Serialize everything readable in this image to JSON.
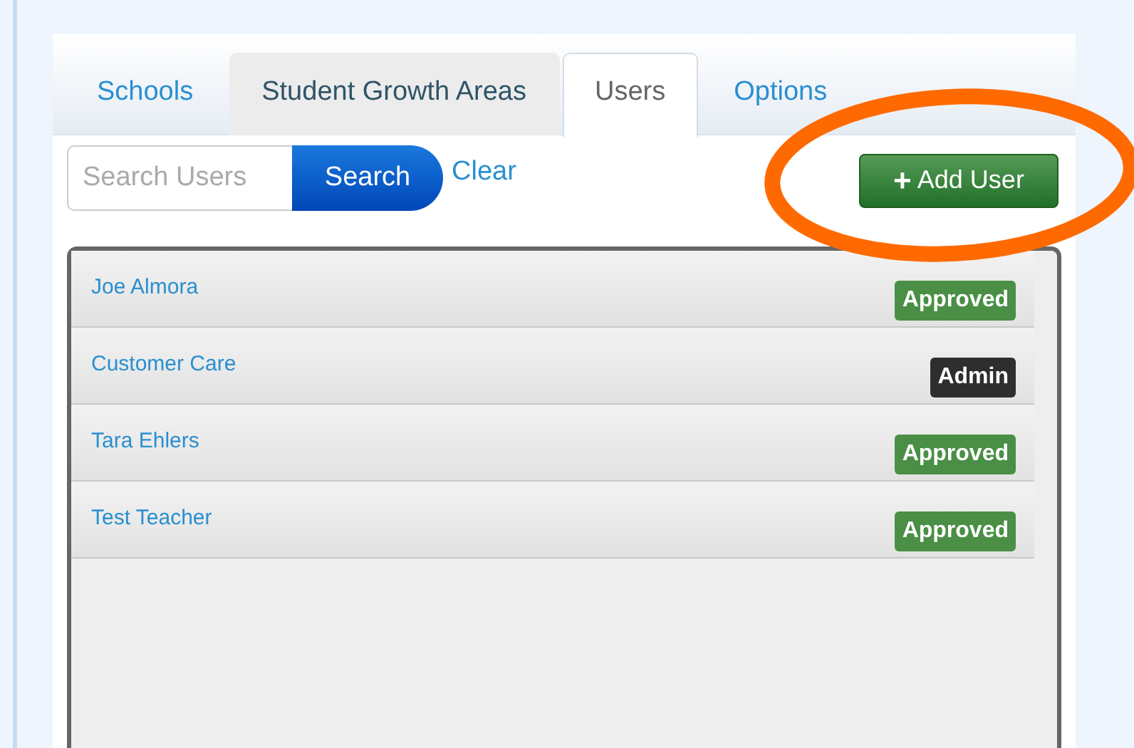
{
  "tabs": [
    {
      "label": "Schools",
      "selected": false,
      "hovered": false
    },
    {
      "label": "Student Growth Areas",
      "selected": false,
      "hovered": true
    },
    {
      "label": "Users",
      "selected": true,
      "hovered": false
    },
    {
      "label": "Options",
      "selected": false,
      "hovered": false
    }
  ],
  "search": {
    "placeholder": "Search Users",
    "button": "Search",
    "clear": "Clear"
  },
  "add_button": {
    "icon": "+",
    "label": "Add User"
  },
  "users": [
    {
      "name": "Joe Almora",
      "status": "Approved",
      "color": "#4a8f45"
    },
    {
      "name": "Customer Care",
      "status": "Admin",
      "color": "#2e2e2e"
    },
    {
      "name": "Tara Ehlers",
      "status": "Approved",
      "color": "#4a8f45"
    },
    {
      "name": "Test Teacher",
      "status": "Approved",
      "color": "#4a8f45"
    }
  ]
}
